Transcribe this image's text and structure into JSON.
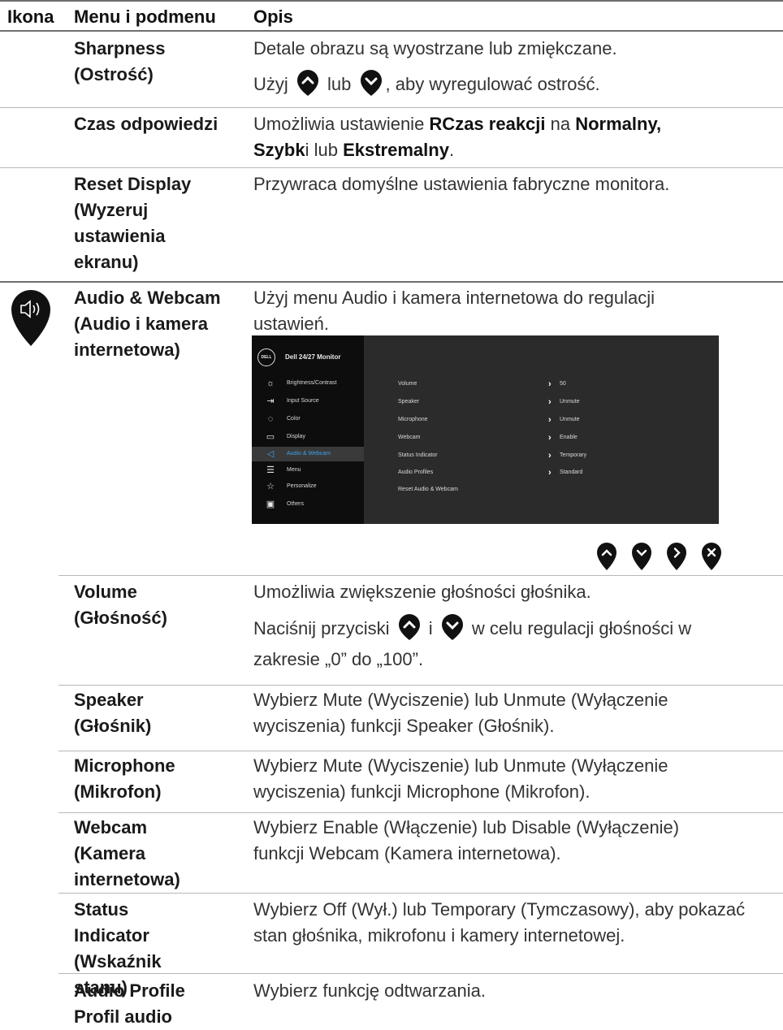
{
  "header": {
    "col_icon": "Ikona",
    "col_menu": "Menu i podmenu",
    "col_desc": "Opis"
  },
  "rows": {
    "sharpness": {
      "name": "Sharpness (Ostrość)",
      "desc1": "Detale obrazu są wyostrzane lub zmiękczane.",
      "desc2_a": "Użyj",
      "desc2_b": "lub",
      "desc2_c": ", aby wyregulować ostrość."
    },
    "response": {
      "name": "Czas odpowiedzi",
      "d_a": "Umożliwia ustawienie ",
      "d_b": "RCzas reakcji",
      "d_c": " na ",
      "d_d": "Normalny,",
      "d_e": "Szybk",
      "d_f": "i lub ",
      "d_g": "Ekstremalny",
      "d_h": "."
    },
    "reset": {
      "name": "Reset Display (Wyzeruj ustawienia ekranu)",
      "desc": "Przywraca domyślne ustawienia fabryczne monitora."
    },
    "audio": {
      "name": "Audio & Webcam (Audio i kamera internetowa)",
      "desc": "Użyj menu Audio i kamera internetowa do regulacji ustawień."
    },
    "volume": {
      "name": "Volume (Głośność)",
      "desc1": "Umożliwia zwiększenie głośności głośnika.",
      "desc2_a": "Naciśnij przyciski",
      "desc2_b": "i",
      "desc2_c": "w celu regulacji głośności w zakresie „0” do „100”."
    },
    "speaker": {
      "name": "Speaker (Głośnik)",
      "desc": "Wybierz Mute (Wyciszenie) lub Unmute (Wyłączenie wyciszenia) funkcji Speaker (Głośnik)."
    },
    "microphone": {
      "name": "Microphone (Mikrofon)",
      "desc": "Wybierz Mute (Wyciszenie) lub Unmute (Wyłączenie wyciszenia) funkcji Microphone (Mikrofon)."
    },
    "webcam": {
      "name": "Webcam (Kamera internetowa)",
      "desc": "Wybierz Enable (Włączenie) lub Disable (Wyłączenie) funkcji Webcam (Kamera internetowa)."
    },
    "status": {
      "name": "Status Indicator (Wskaźnik stanu)",
      "desc": "Wybierz Off (Wył.) lub Temporary (Tymczasowy), aby pokazać stan głośnika, mikrofonu i kamery internetowej."
    },
    "profile": {
      "name": "Audio Profile Profil audio",
      "desc": "Wybierz funkcję odtwarzania."
    }
  },
  "osd": {
    "logo": "DELL",
    "title": "Dell 24/27 Monitor",
    "menu": [
      {
        "label": "Brightness/Contrast",
        "icon": "brightness-icon"
      },
      {
        "label": "Input Source",
        "icon": "input-source-icon"
      },
      {
        "label": "Color",
        "icon": "color-palette-icon"
      },
      {
        "label": "Display",
        "icon": "display-icon"
      },
      {
        "label": "Audio & Webcam",
        "icon": "speaker-icon",
        "selected": true
      },
      {
        "label": "Menu",
        "icon": "menu-icon"
      },
      {
        "label": "Personalize",
        "icon": "star-icon"
      },
      {
        "label": "Others",
        "icon": "others-icon"
      }
    ],
    "settings": [
      {
        "label": "Volume",
        "value": "50"
      },
      {
        "label": "Speaker",
        "value": "Unmute"
      },
      {
        "label": "Microphone",
        "value": "Unmute"
      },
      {
        "label": "Webcam",
        "value": "Enable"
      },
      {
        "label": "Status Indicator",
        "value": "Temporary"
      },
      {
        "label": "Audio Profiles",
        "value": "Standard"
      },
      {
        "label": "Reset Audio & Webcam",
        "value": ""
      }
    ]
  },
  "nav_buttons": [
    "up-button-icon",
    "down-button-icon",
    "right-button-icon",
    "close-button-icon"
  ],
  "colors": {
    "button": "#111111",
    "selected": "#3aa4ee",
    "osd_bg": "#2b2b2b",
    "osd_left": "#0d0d0d"
  }
}
